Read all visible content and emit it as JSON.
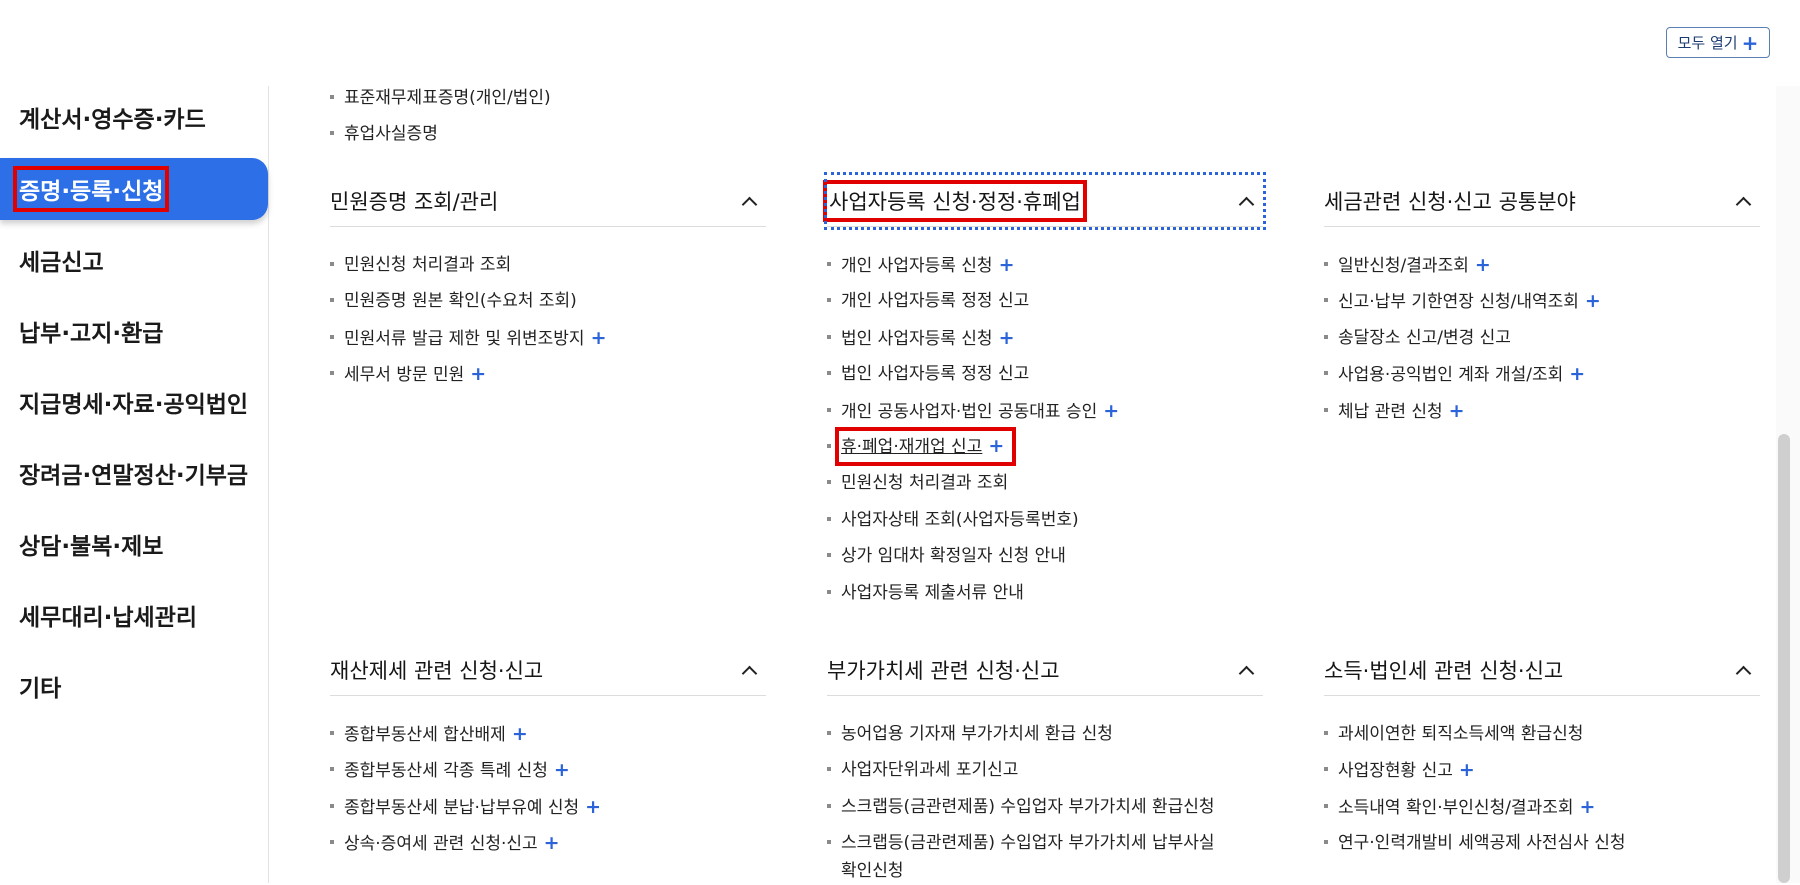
{
  "expand_all": {
    "label": "모두 열기",
    "icon": "plus-icon"
  },
  "sidebar": {
    "items": [
      {
        "label": "계산서·영수증·카드"
      },
      {
        "label": "증명·등록·신청"
      },
      {
        "label": "세금신고"
      },
      {
        "label": "납부·고지·환급"
      },
      {
        "label": "지급명세·자료·공익법인"
      },
      {
        "label": "장려금·연말정산·기부금"
      },
      {
        "label": "상담·불복·제보"
      },
      {
        "label": "세무대리·납세관리"
      },
      {
        "label": "기타"
      }
    ]
  },
  "top_list": [
    "표준재무제표증명(개인/법인)",
    "휴업사실증명"
  ],
  "sections": [
    {
      "title": "민원증명 조회/관리",
      "items": [
        "민원신청 처리결과 조회",
        "민원증명 원본 확인(수요처 조회)",
        "민원서류 발급 제한 및 위변조방지",
        "세무서 방문 민원"
      ]
    },
    {
      "title": "사업자등록 신청·정정·휴폐업",
      "items": [
        "개인 사업자등록 신청",
        "개인 사업자등록 정정 신고",
        "법인 사업자등록 신청",
        "법인 사업자등록 정정 신고",
        "개인 공동사업자·법인 공동대표 승인",
        "휴·폐업·재개업 신고",
        "민원신청 처리결과 조회",
        "사업자상태 조회(사업자등록번호)",
        "상가 임대차 확정일자 신청 안내",
        "사업자등록 제출서류 안내"
      ]
    },
    {
      "title": "세금관련 신청·신고 공통분야",
      "items": [
        "일반신청/결과조회",
        "신고·납부 기한연장 신청/내역조회",
        "송달장소 신고/변경 신고",
        "사업용·공익법인 계좌 개설/조회",
        "체납 관련 신청"
      ]
    },
    {
      "title": "재산제세 관련 신청·신고",
      "items": [
        "종합부동산세 합산배제",
        "종합부동산세 각종 특례 신청",
        "종합부동산세 분납·납부유예 신청",
        "상속·증여세 관련 신청·신고"
      ]
    },
    {
      "title": "부가가치세 관련 신청·신고",
      "items": [
        "농어업용 기자재 부가가치세 환급 신청",
        "사업자단위과세 포기신고",
        "스크랩등(금관련제품) 수입업자 부가가치세 환급신청",
        "스크랩등(금관련제품) 수입업자 부가가치세 납부사실",
        "확인신청"
      ]
    },
    {
      "title": "소득·법인세 관련 신청·신고",
      "items": [
        "과세이연한 퇴직소득세액 환급신청",
        "사업장현황 신고",
        "소득내역 확인·부인신청/결과조회",
        "연구·인력개발비 세액공제 사전심사 신청"
      ]
    }
  ]
}
